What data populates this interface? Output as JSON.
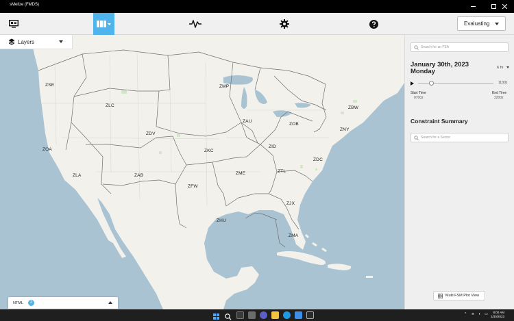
{
  "window": {
    "title": "sMelize (FMDS)",
    "minimize_icon": "minimize-icon",
    "maximize_icon": "maximize-icon",
    "close_icon": "close-icon"
  },
  "toolbar": {
    "monitor_icon": "monitor-icon",
    "map_view_icon": "map-columns-icon",
    "activity_icon": "activity-pulse-icon",
    "settings_icon": "gear-icon",
    "help_icon": "help-circle-icon",
    "mode_select": "Evaluating",
    "active_color": "#4fb3ec"
  },
  "map": {
    "layers_label": "Layers",
    "ntml_label": "NTML",
    "ntml_count": "2",
    "zones": [
      {
        "label": "ZSE"
      },
      {
        "label": "ZLC"
      },
      {
        "label": "ZMP"
      },
      {
        "label": "ZAU"
      },
      {
        "label": "ZOB"
      },
      {
        "label": "ZBW"
      },
      {
        "label": "ZNY"
      },
      {
        "label": "ZDV"
      },
      {
        "label": "ZOA"
      },
      {
        "label": "ZKC"
      },
      {
        "label": "ZID"
      },
      {
        "label": "ZDC"
      },
      {
        "label": "ZLA"
      },
      {
        "label": "ZAB"
      },
      {
        "label": "ZME"
      },
      {
        "label": "ZTL"
      },
      {
        "label": "ZFW"
      },
      {
        "label": "ZJX"
      },
      {
        "label": "ZHU"
      },
      {
        "label": "ZMA"
      }
    ]
  },
  "panel": {
    "fea_search_placeholder": "Search for an FEA",
    "date": "January 30th, 2023",
    "weekday": "Monday",
    "range": "6 hr",
    "slider_end": "1130z",
    "start_time_label": "Start Time",
    "start_time_value": "0700z",
    "end_time_label": "End Time",
    "end_time_value": "2200z",
    "constraint_title": "Constraint Summary",
    "sector_search_placeholder": "Search for a Sector",
    "multi_plot_button": "Multi FSM Plot View"
  },
  "taskbar": {
    "clock_time": "8:00 AM",
    "clock_date": "1/30/2023"
  }
}
